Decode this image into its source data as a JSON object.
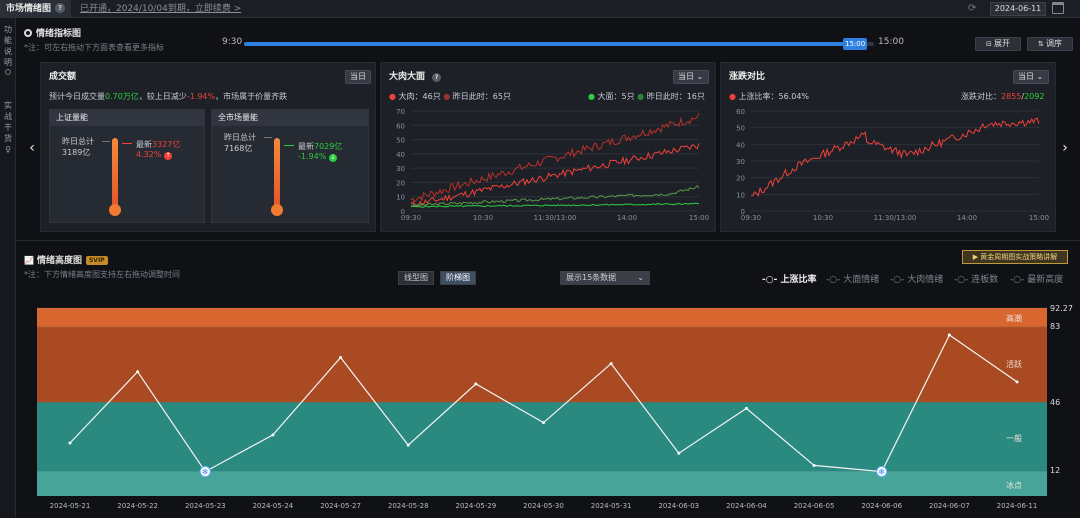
{
  "topbar": {
    "tab_label": "市场情绪图",
    "help_icon": "?",
    "notice": "已开通，2024/10/04到期，立即续费 >",
    "date": "2024-06-11"
  },
  "sidebar": {
    "item1": [
      "功",
      "能",
      "说",
      "明"
    ],
    "item2": [
      "实",
      "战",
      "干",
      "货"
    ]
  },
  "indicator": {
    "title": "情绪指标图",
    "note": "*注：可左右拖动下方面表查看更多指标",
    "time_start": "9:30",
    "time_end": "15:00",
    "handle_label": "15:00",
    "expand_label": "展开",
    "sort_label": "调序",
    "progress": 0.97
  },
  "turnover": {
    "title": "成交额",
    "today": "当日",
    "desc_pre": "预计今日成交量",
    "desc_val": "0.70万亿",
    "desc_mid": "，较上日减少",
    "desc_pct": "-1.94%",
    "desc_post": "，市场属于价量齐跌",
    "sh": {
      "title": "上证量能",
      "prev_label": "昨日总计",
      "prev_value": "3189亿",
      "latest_label": "最新",
      "latest_value": "3327亿",
      "latest_pct": "4.32%"
    },
    "all": {
      "title": "全市场量能",
      "prev_label": "昨日总计",
      "prev_value": "7168亿",
      "latest_label": "最新",
      "latest_value": "7029亿",
      "latest_pct": "-1.94%"
    }
  },
  "bigmove": {
    "title": "大肉大面",
    "today": "当日",
    "l1_label": "大肉：",
    "l1_value": "46只",
    "l2_label": "昨日此时：",
    "l2_value": "65只",
    "l3_label": "大面：",
    "l3_value": "5只",
    "l4_label": "昨日此时：",
    "l4_value": "16只",
    "yticks": [
      "70",
      "60",
      "50",
      "40",
      "30",
      "20",
      "10",
      "0"
    ],
    "xticks": [
      "09:30",
      "10:30",
      "11:30/13:00",
      "14:00",
      "15:00"
    ]
  },
  "updown": {
    "title": "涨跌对比",
    "today": "当日",
    "rise_label": "上涨比率：",
    "rise_value": "56.04%",
    "cmp_label": "涨跌对比：",
    "cmp_up": "2855",
    "cmp_sep": "/",
    "cmp_down": "2092",
    "yticks": [
      "60",
      "50",
      "40",
      "30",
      "20",
      "10",
      "0"
    ],
    "xticks": [
      "09:30",
      "10:30",
      "11:30/13:00",
      "14:00",
      "15:00"
    ]
  },
  "height": {
    "title": "情绪高度图",
    "badge": "SVIP",
    "note": "*注：下方情绪高度图支持左右拖动调整时间",
    "promo": "黄金周期图实战策略讲解",
    "view_line": "线型图",
    "view_step": "阶梯图",
    "dropdown": "展示15条数据",
    "legend": [
      "上涨比率",
      "大面情绪",
      "大肉情绪",
      "连板数",
      "最新高度"
    ],
    "zones": [
      "高潮",
      "活跃",
      "一般",
      "冰点"
    ],
    "yticks": [
      "92.27",
      "83",
      "46",
      "12"
    ]
  },
  "colors": {
    "accent_blue": "#2f7fe0",
    "rise_red": "#f0413a",
    "fall_green": "#2ecc40",
    "zone_top": "#d9662e",
    "zone_active": "#a94a22",
    "zone_normal": "#2a8a7f",
    "zone_ice": "#46a598"
  },
  "chart_data": [
    {
      "type": "line",
      "x": [
        "2024-05-21",
        "2024-05-22",
        "2024-05-23",
        "2024-05-24",
        "2024-05-27",
        "2024-05-28",
        "2024-05-29",
        "2024-05-30",
        "2024-05-31",
        "2024-06-03",
        "2024-06-04",
        "2024-06-05",
        "2024-06-06",
        "2024-06-07",
        "2024-06-11"
      ],
      "series": [
        {
          "name": "上涨比率",
          "values": [
            26,
            61,
            12,
            30,
            68,
            25,
            55,
            36,
            65,
            21,
            43,
            15,
            12,
            79,
            56
          ]
        }
      ],
      "ylim": [
        0,
        92.27
      ],
      "yticks": [
        12,
        46,
        83,
        92.27
      ]
    }
  ]
}
